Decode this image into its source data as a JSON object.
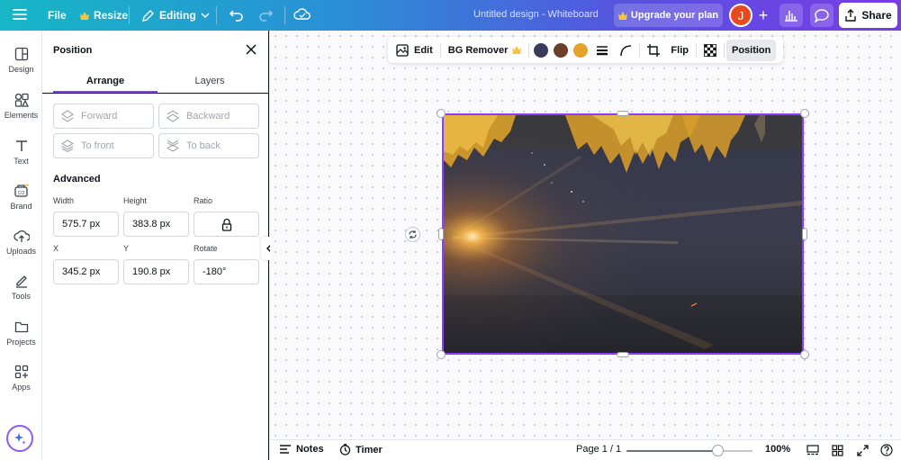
{
  "topbar": {
    "menu_icon": "hamburger-icon",
    "file_label": "File",
    "resize_label": "Resize",
    "editing_label": "Editing",
    "doc_title": "Untitled design - Whiteboard",
    "upgrade_label": "Upgrade your plan",
    "avatar_initial": "J",
    "plus_label": "+",
    "share_label": "Share",
    "gradient_colors": [
      "#16b7c6",
      "#2a8fd6",
      "#5a4fe0",
      "#7a3ce6"
    ]
  },
  "rail": {
    "items": [
      {
        "label": "Design",
        "icon": "layout-icon"
      },
      {
        "label": "Elements",
        "icon": "shapes-icon"
      },
      {
        "label": "Text",
        "icon": "text-icon"
      },
      {
        "label": "Brand",
        "icon": "brand-icon"
      },
      {
        "label": "Uploads",
        "icon": "cloud-upload-icon"
      },
      {
        "label": "Tools",
        "icon": "pen-icon"
      },
      {
        "label": "Projects",
        "icon": "folder-icon"
      },
      {
        "label": "Apps",
        "icon": "apps-icon"
      }
    ],
    "magic_icon": "sparkle-icon"
  },
  "panel": {
    "title": "Position",
    "tabs": [
      "Arrange",
      "Layers"
    ],
    "active_tab": "Arrange",
    "arrange_buttons": [
      "Forward",
      "Backward",
      "To front",
      "To back"
    ],
    "advanced_title": "Advanced",
    "fields": {
      "width_label": "Width",
      "width_value": "575.7 px",
      "height_label": "Height",
      "height_value": "383.8 px",
      "ratio_label": "Ratio",
      "ratio_icon": "lock-icon",
      "x_label": "X",
      "x_value": "345.2 px",
      "y_label": "Y",
      "y_value": "190.8 px",
      "rotate_label": "Rotate",
      "rotate_value": "-180°"
    }
  },
  "toolbar": {
    "edit_label": "Edit",
    "bg_remover_label": "BG Remover",
    "swatches": [
      "#3a3a5a",
      "#6b3f2a",
      "#e4a32c"
    ],
    "flip_label": "Flip",
    "position_label": "Position"
  },
  "bottombar": {
    "notes_label": "Notes",
    "timer_label": "Timer",
    "page_label": "Page 1 / 1",
    "zoom_label": "100%",
    "zoom_level": 0.72
  },
  "accent": "#8b3dff"
}
